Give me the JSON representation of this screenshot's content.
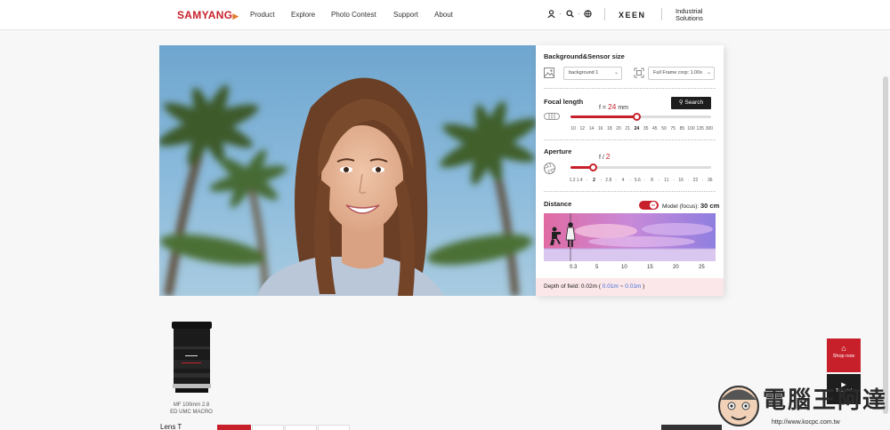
{
  "brand": {
    "logo": "SAMYANG",
    "accent": "#c8202a"
  },
  "nav": {
    "items": [
      "Product",
      "Explore",
      "Photo Contest",
      "Support",
      "About"
    ]
  },
  "header_right": {
    "xeen": "XEEN",
    "industrial": "Industrial Solutions",
    "icons": [
      "user-icon",
      "search-icon",
      "globe-icon"
    ]
  },
  "panel": {
    "background": {
      "title": "Background&Sensor size",
      "background_select": "background 1",
      "sensor_select": "Full Frame crop: 1.00x"
    },
    "focal": {
      "title": "Focal length",
      "readout_prefix": "f = ",
      "value": "24",
      "unit": " mm",
      "search_label": "Search",
      "ticks": [
        "10",
        "12",
        "14",
        "16",
        "18",
        "20",
        "21",
        "24",
        "35",
        "45",
        "50",
        "75",
        "85",
        "100",
        "135",
        "300"
      ],
      "active_tick": "24",
      "slider_fraction": 0.47
    },
    "aperture": {
      "title": "Aperture",
      "readout_prefix": "f / ",
      "value": "2",
      "ticks": [
        "1.2",
        "1.4",
        "·",
        "2",
        "·",
        "2.8",
        "·",
        "4",
        "·",
        "5.6",
        "·",
        "8",
        "·",
        "11",
        "·",
        "16",
        "·",
        "22",
        "·",
        "36"
      ],
      "active_tick": "2",
      "slider_fraction": 0.16
    },
    "distance": {
      "title": "Distance",
      "toggle_label": "on",
      "model_label": "Model (focus): ",
      "model_value": "30 cm",
      "ticks": [
        "0.3",
        "5",
        "10",
        "15",
        "20",
        "25"
      ]
    },
    "dof": {
      "label": "Depth of field: ",
      "value": "0.02m",
      "open": " ( ",
      "near": "0.01m",
      "sep": " ~ ",
      "far": "0.01m",
      "close": " )"
    }
  },
  "product": {
    "caption_line1": "MF 100mm 2.8",
    "caption_line2": "ED UMC MACRO"
  },
  "floating": {
    "shop_label": "Shop now",
    "tutorial_label": "Tutorial"
  },
  "watermark": {
    "text": "電腦王阿達",
    "url": "http://www.kocpc.com.tw"
  },
  "bottom": {
    "partial_text": "Lens T"
  }
}
